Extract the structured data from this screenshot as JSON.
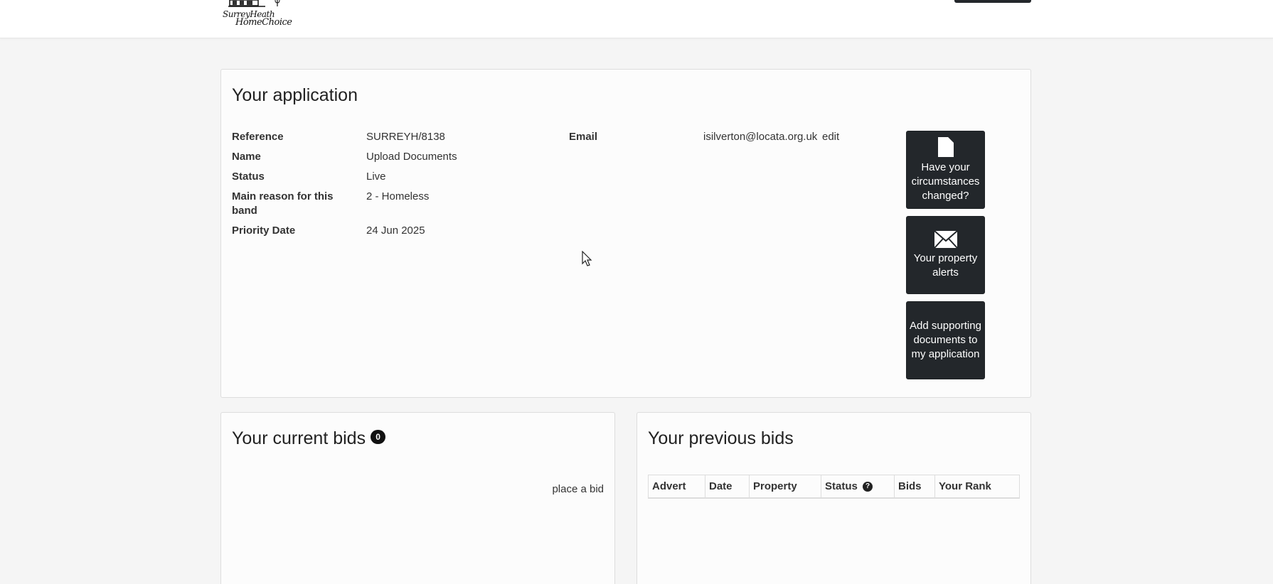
{
  "header": {
    "logo_line1": "SurreyHeath",
    "logo_line2": "HomeChoice"
  },
  "application": {
    "title": "Your application",
    "fields": {
      "reference": {
        "label": "Reference",
        "value": "SURREYH/8138"
      },
      "name": {
        "label": "Name",
        "value": "Upload Documents"
      },
      "status": {
        "label": "Status",
        "value": "Live"
      },
      "main_reason": {
        "label": "Main reason for this band",
        "value": "2 - Homeless"
      },
      "priority_date": {
        "label": "Priority Date",
        "value": "24 Jun 2025"
      },
      "email": {
        "label": "Email",
        "value": "isilverton@locata.org.uk",
        "edit_label": "edit"
      }
    },
    "actions": {
      "circumstances": {
        "label": "Have your circumstances changed?",
        "icon": "document-icon"
      },
      "alerts": {
        "label": "Your property alerts",
        "icon": "envelope-icon"
      },
      "documents": {
        "label": "Add supporting documents to my application"
      }
    }
  },
  "current_bids": {
    "title": "Your current bids",
    "count": "0",
    "place_bid_label": "place a bid"
  },
  "previous_bids": {
    "title": "Your previous bids",
    "columns": [
      "Advert",
      "Date",
      "Property",
      "Status",
      "Bids",
      "Your Rank"
    ]
  },
  "colors": {
    "button_dark": "#23272b",
    "page_background": "#f5f5f5",
    "panel_background": "#fcfcfc"
  }
}
